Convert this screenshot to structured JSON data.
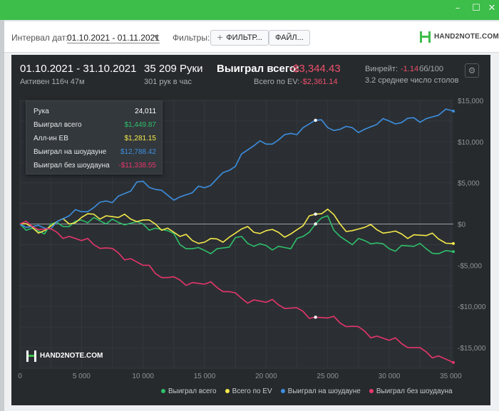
{
  "window": {
    "minimize": "–",
    "maximize": "☐",
    "close": "✕"
  },
  "filters": {
    "date_label": "Интервал дат:",
    "date_value": "01.10.2021 - 01.11.2021",
    "filters_label": "Фильтры:",
    "filter_button": "ФИЛЬТР...",
    "file_button": "ФАЙЛ...",
    "brand": "HAND2NOTE.COM"
  },
  "header": {
    "date_range": "01.10.2021 - 31.10.2021",
    "active": "Активен 116ч 47м",
    "hands": "35 209 Руки",
    "hands_per_hour": "301 рук в час",
    "won_label": "Выиграл всего:",
    "won_value": "-$3,344.43",
    "ev_label": "Всего по EV:",
    "ev_value": "-$2,361.14",
    "winrate_label": "Винрейт:",
    "winrate_value": "-1.14",
    "winrate_unit": "бб/100",
    "tables": "3.2 среднее число столов"
  },
  "tooltip": {
    "rows": [
      {
        "label": "Рука",
        "value": "24,011",
        "color": "#ffffff"
      },
      {
        "label": "Выиграл всего",
        "value": "$1,449.87",
        "color": "#2fbf6b"
      },
      {
        "label": "Алл-ин ЕВ",
        "value": "$1,281.15",
        "color": "#f5e94a"
      },
      {
        "label": "Выиграл на шоудауне",
        "value": "$12,788.42",
        "color": "#3d8fe0"
      },
      {
        "label": "Выиграл без шоудауна",
        "value": "-$11,338.55",
        "color": "#e8356b"
      }
    ]
  },
  "watermark": "HAND2NOTE.COM",
  "chart_data": {
    "type": "line",
    "xlim": [
      0,
      35209
    ],
    "ylim": [
      -17500,
      15000
    ],
    "x_ticks": [
      0,
      5000,
      10000,
      15000,
      20000,
      25000,
      30000,
      35000
    ],
    "x_tick_labels": [
      "0",
      "5 000",
      "10 000",
      "15 000",
      "20 000",
      "25 000",
      "30 000",
      "35 000"
    ],
    "y_ticks": [
      15000,
      10000,
      5000,
      0,
      -5000,
      -10000,
      -15000
    ],
    "y_tick_labels": [
      "$15,000",
      "$10,000",
      "$5,000",
      "$0",
      "-$5,000",
      "-$10,000",
      "-$15,000"
    ],
    "grid": true,
    "legend_position": "bottom",
    "x": [
      0,
      1000,
      2000,
      3000,
      4000,
      5000,
      6000,
      7000,
      8000,
      9000,
      10000,
      11000,
      12000,
      13000,
      14000,
      15000,
      16000,
      17000,
      18000,
      19000,
      20000,
      21000,
      22000,
      23000,
      24000,
      25000,
      26000,
      27000,
      28000,
      29000,
      30000,
      31000,
      32000,
      33000,
      34000,
      35209
    ],
    "series": [
      {
        "name": "Выиграл всего",
        "color": "#2fbf6b",
        "values": [
          0,
          -500,
          -1200,
          200,
          -300,
          500,
          800,
          0,
          200,
          100,
          0,
          -500,
          -800,
          -2500,
          -3000,
          -3200,
          -3000,
          -2800,
          -1500,
          -2700,
          -2600,
          -2700,
          -3000,
          -1500,
          0,
          1000,
          -1500,
          -2500,
          -2000,
          -2300,
          -3000,
          -2600,
          -2700,
          -3000,
          -3600,
          -3344
        ]
      },
      {
        "name": "Всего по EV",
        "color": "#f5e94a",
        "values": [
          0,
          -400,
          -800,
          300,
          0,
          800,
          1200,
          1000,
          800,
          600,
          500,
          0,
          -500,
          -1500,
          -2000,
          -2200,
          -1800,
          -1600,
          -600,
          -1000,
          -800,
          -1000,
          -1200,
          -200,
          1200,
          1800,
          0,
          -800,
          -400,
          -700,
          -1000,
          -1200,
          -1300,
          -1400,
          -1800,
          -2361
        ]
      },
      {
        "name": "Выиграл на шоудауне",
        "color": "#3d8fe0",
        "values": [
          0,
          -300,
          -500,
          300,
          1000,
          1500,
          2000,
          2800,
          3400,
          4000,
          5200,
          4200,
          3500,
          3300,
          3800,
          4400,
          5500,
          6500,
          8500,
          9500,
          9700,
          10200,
          11000,
          11700,
          12600,
          11700,
          11500,
          11700,
          11500,
          12100,
          12500,
          12300,
          12900,
          12800,
          13200,
          13700
        ]
      },
      {
        "name": "Выиграл без шоудауна",
        "color": "#e8356b",
        "values": [
          0,
          -300,
          -600,
          -1000,
          -1500,
          -2000,
          -2500,
          -2900,
          -3500,
          -4200,
          -5000,
          -6000,
          -6500,
          -6800,
          -7100,
          -7300,
          -7700,
          -8200,
          -9000,
          -9200,
          -9500,
          -9800,
          -10200,
          -10600,
          -11300,
          -11400,
          -12000,
          -12400,
          -13000,
          -13600,
          -14100,
          -14500,
          -15000,
          -15500,
          -16000,
          -16800
        ]
      }
    ]
  }
}
